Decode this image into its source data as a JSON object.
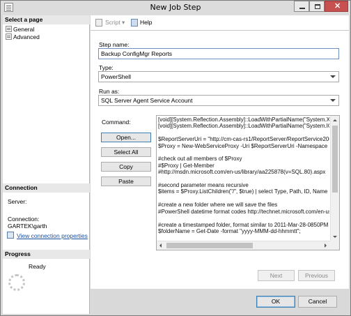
{
  "window": {
    "title": "New Job Step"
  },
  "left": {
    "select_page_header": "Select a page",
    "pages": [
      {
        "label": "General"
      },
      {
        "label": "Advanced"
      }
    ],
    "connection_header": "Connection",
    "server_label": "Server:",
    "server_value": "",
    "connection_label": "Connection:",
    "connection_value": "GARTEK\\garth",
    "view_props_link": "View connection properties",
    "progress_header": "Progress",
    "progress_status": "Ready"
  },
  "toolbar": {
    "script_label": "Script",
    "help_label": "Help"
  },
  "form": {
    "step_name_label": "Step name:",
    "step_name_value": "Backup ConfigMgr Reports",
    "type_label": "Type:",
    "type_value": "PowerShell",
    "run_as_label": "Run as:",
    "run_as_value": "SQL Server Agent Service Account",
    "command_label": "Command:",
    "command_text": "[void][System.Reflection.Assembly]::LoadWithPartialName(\"System.Xml\n[void][System.Reflection.Assembly]::LoadWithPartialName(\"System.IO\")\n\n$ReportServerUri = \"http://cm-cas-rs1/ReportServer/ReportService200\n$Proxy = New-WebServiceProxy -Uri $ReportServerUri -Namespace SS\n\n#check out all members of $Proxy\n#$Proxy | Get-Member\n#http://msdn.microsoft.com/en-us/library/aa225878(v=SQL.80).aspx\n\n#second parameter means recursive\n$items = $Proxy.ListChildren(\"/\", $true) | select Type, Path, ID, Name | W\n\n#create a new folder where we will save the files\n#PowerShell datetime format codes http://technet.microsoft.com/en-us\n\n#create a timestamped folder, format similar to 2011-Mar-28-0850PM\n$folderName = Get-Date -format \"yyyy-MMM-dd-hhmmtt\";",
    "buttons": {
      "open": "Open...",
      "select_all": "Select All",
      "copy": "Copy",
      "paste": "Paste"
    }
  },
  "nav": {
    "next": "Next",
    "previous": "Previous"
  },
  "dialog": {
    "ok": "OK",
    "cancel": "Cancel"
  },
  "colors": {
    "link": "#1a4fa0",
    "close_button": "#c75050",
    "focus_border": "#3c7fb1"
  }
}
